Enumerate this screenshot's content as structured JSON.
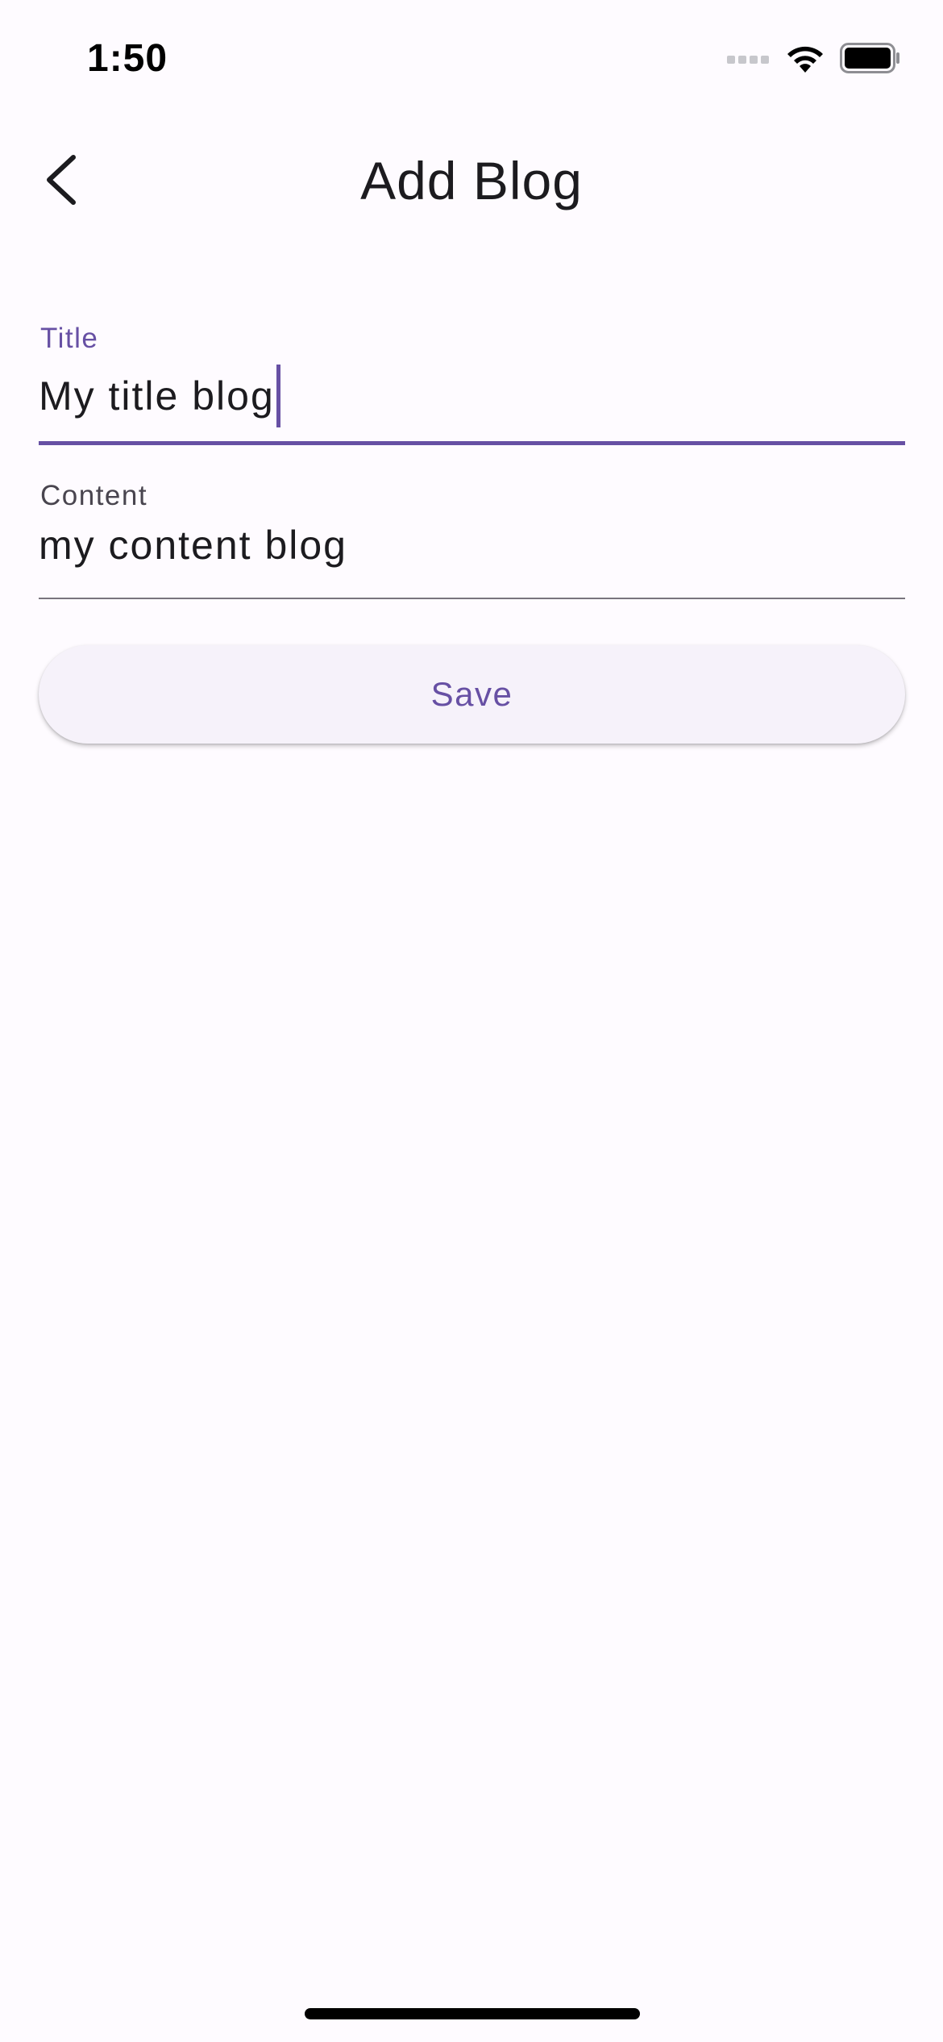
{
  "status_bar": {
    "time": "1:50",
    "signal_icon": "cellular-signal-icon",
    "wifi_icon": "wifi-icon",
    "battery_icon": "battery-icon"
  },
  "app_bar": {
    "back_icon": "chevron-left-icon",
    "title": "Add Blog"
  },
  "form": {
    "title_field": {
      "label": "Title",
      "value": "My title blog",
      "focused": true
    },
    "content_field": {
      "label": "Content",
      "value": "my content blog",
      "focused": false
    },
    "save_label": "Save"
  },
  "colors": {
    "primary": "#6750a4",
    "background": "#fefbff",
    "button_surface": "#f6f2fa",
    "text": "#1c1b1f",
    "outline": "#79747e"
  }
}
